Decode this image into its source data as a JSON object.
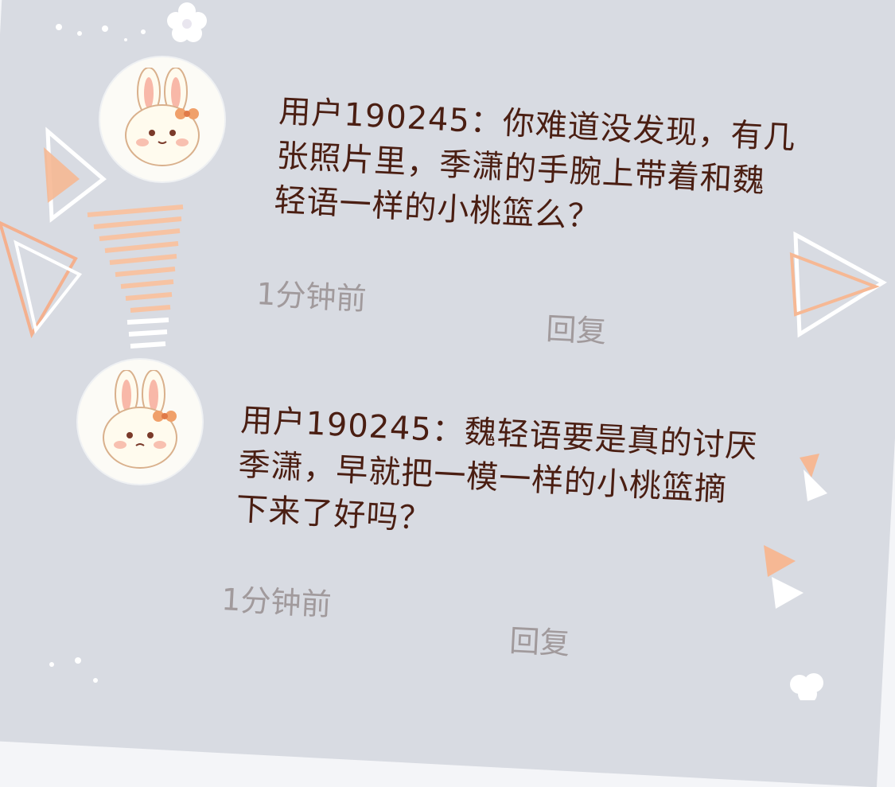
{
  "comments": [
    {
      "lines": [
        "用户190245：你难道没发现，有几",
        "张照片里，季潇的手腕上带着和魏",
        "轻语一样的小桃篮么？"
      ],
      "time": "1分钟前",
      "reply_label": "回复",
      "avatar_icon": "bunny-avatar-icon"
    },
    {
      "lines": [
        "用户190245：魏轻语要是真的讨厌",
        "季潇，早就把一模一样的小桃篮摘",
        "下来了好吗？"
      ],
      "time": "1分钟前",
      "reply_label": "回复",
      "avatar_icon": "bunny-avatar-icon"
    }
  ],
  "colors": {
    "panel": "#d8dbe2",
    "text": "#4a1e12",
    "meta": "#a19a9c",
    "accent": "#f6b894"
  }
}
